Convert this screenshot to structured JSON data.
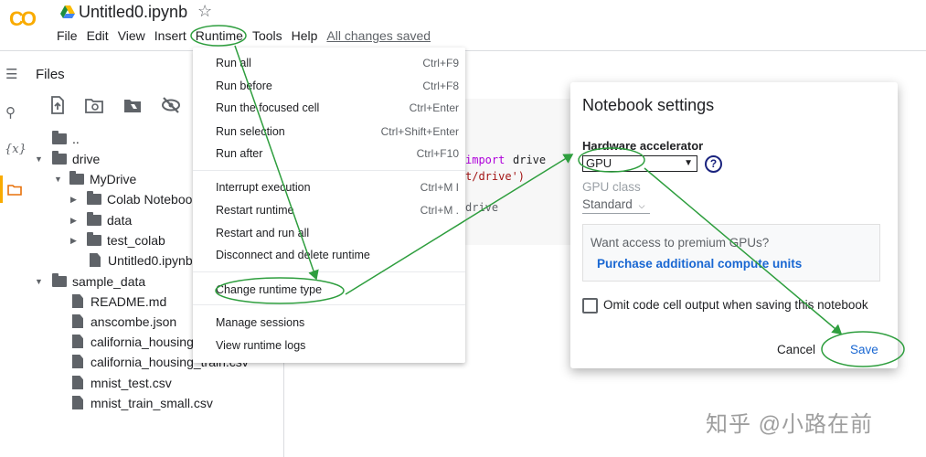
{
  "app": {
    "logo_text": "CO",
    "notebook_title": "Untitled0.ipynb",
    "star_icon": "star-outline-icon"
  },
  "menubar": {
    "items": [
      "File",
      "Edit",
      "View",
      "Insert",
      "Runtime",
      "Tools",
      "Help"
    ],
    "status": "All changes saved"
  },
  "files_panel": {
    "title": "Files",
    "tree": [
      {
        "label": "..",
        "type": "folder-up"
      },
      {
        "label": "drive",
        "type": "folder",
        "expanded": true
      },
      {
        "label": "MyDrive",
        "type": "folder",
        "expanded": true
      },
      {
        "label": "Colab Notebooks",
        "type": "folder",
        "expanded": false
      },
      {
        "label": "data",
        "type": "folder",
        "expanded": false
      },
      {
        "label": "test_colab",
        "type": "folder",
        "expanded": false
      },
      {
        "label": "Untitled0.ipynb",
        "type": "file"
      },
      {
        "label": "sample_data",
        "type": "folder",
        "expanded": true
      },
      {
        "label": "README.md",
        "type": "file"
      },
      {
        "label": "anscombe.json",
        "type": "file"
      },
      {
        "label": "california_housing_",
        "type": "file"
      },
      {
        "label": "california_housing_train.csv",
        "type": "file"
      },
      {
        "label": "mnist_test.csv",
        "type": "file"
      },
      {
        "label": "mnist_train_small.csv",
        "type": "file"
      }
    ]
  },
  "code_fragments": {
    "line1_kw": "import",
    "line1_name": "drive",
    "line2": "t/drive')",
    "line3": "drive"
  },
  "runtime_menu": {
    "items": [
      {
        "label": "Run all",
        "shortcut": "Ctrl+F9"
      },
      {
        "label": "Run before",
        "shortcut": "Ctrl+F8"
      },
      {
        "label": "Run the focused cell",
        "shortcut": "Ctrl+Enter"
      },
      {
        "label": "Run selection",
        "shortcut": "Ctrl+Shift+Enter"
      },
      {
        "label": "Run after",
        "shortcut": "Ctrl+F10"
      },
      {
        "label": "Interrupt execution",
        "shortcut": "Ctrl+M I"
      },
      {
        "label": "Restart runtime",
        "shortcut": "Ctrl+M ."
      },
      {
        "label": "Restart and run all",
        "shortcut": ""
      },
      {
        "label": "Disconnect and delete runtime",
        "shortcut": ""
      },
      {
        "label": "Change runtime type",
        "shortcut": ""
      },
      {
        "label": "Manage sessions",
        "shortcut": ""
      },
      {
        "label": "View runtime logs",
        "shortcut": ""
      }
    ]
  },
  "settings_dialog": {
    "title": "Notebook settings",
    "hardware_label": "Hardware accelerator",
    "hardware_value": "GPU",
    "gpu_class_label": "GPU class",
    "gpu_class_value": "Standard",
    "promo_question": "Want access to premium GPUs?",
    "promo_link": "Purchase additional compute units",
    "omit_output_label": "Omit code cell output when saving this notebook",
    "omit_output_checked": false,
    "cancel_label": "Cancel",
    "save_label": "Save"
  },
  "annotation_color": "#2e9e3e",
  "watermark": "知乎 @小路在前"
}
